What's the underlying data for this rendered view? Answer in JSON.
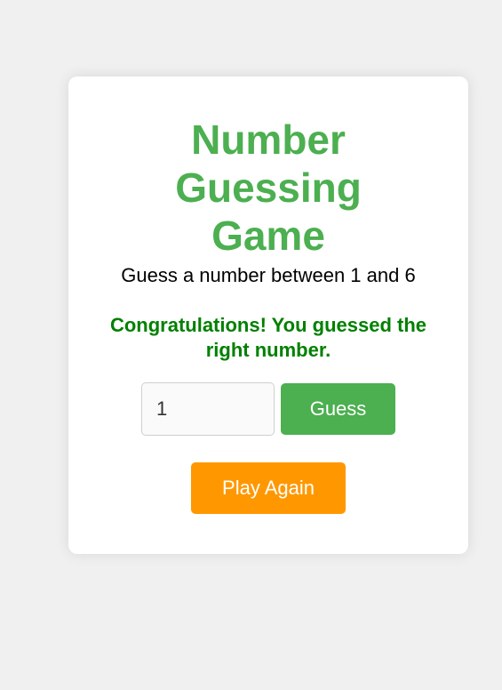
{
  "game": {
    "title": "Number Guessing Game",
    "instructions": "Guess a number between 1 and 6",
    "message": "Congratulations! You guessed the right number.",
    "guess_input_value": "1",
    "guess_button_label": "Guess",
    "play_again_label": "Play Again"
  },
  "colors": {
    "background": "#f0f0f0",
    "card": "#ffffff",
    "title": "#4caf50",
    "message": "#008000",
    "guess_button": "#4caf50",
    "play_again_button": "#ff9800"
  }
}
